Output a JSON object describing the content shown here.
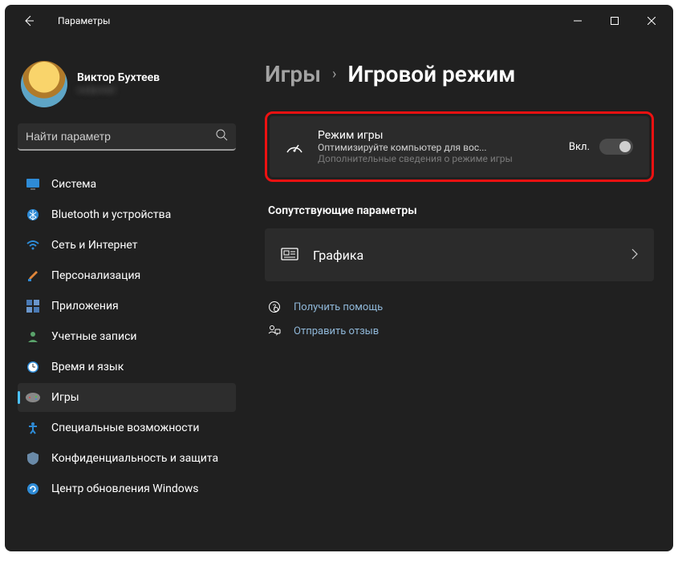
{
  "window": {
    "title": "Параметры"
  },
  "account": {
    "name": "Виктор Бухтеев",
    "sub": "redacted"
  },
  "search": {
    "placeholder": "Найти параметр"
  },
  "sidebar": {
    "items": [
      {
        "label": "Система"
      },
      {
        "label": "Bluetooth и устройства"
      },
      {
        "label": "Сеть и Интернет"
      },
      {
        "label": "Персонализация"
      },
      {
        "label": "Приложения"
      },
      {
        "label": "Учетные записи"
      },
      {
        "label": "Время и язык"
      },
      {
        "label": "Игры"
      },
      {
        "label": "Специальные возможности"
      },
      {
        "label": "Конфиденциальность и защита"
      },
      {
        "label": "Центр обновления Windows"
      }
    ]
  },
  "breadcrumb": {
    "parent": "Игры",
    "current": "Игровой режим"
  },
  "gamemode": {
    "title": "Режим игры",
    "desc": "Оптимизируйте компьютер для вос...",
    "link": "Дополнительные сведения о режиме игры",
    "state_label": "Вкл."
  },
  "related": {
    "heading": "Сопутствующие параметры",
    "graphics": "Графика"
  },
  "help": {
    "get_help": "Получить помощь",
    "feedback": "Отправить отзыв"
  }
}
